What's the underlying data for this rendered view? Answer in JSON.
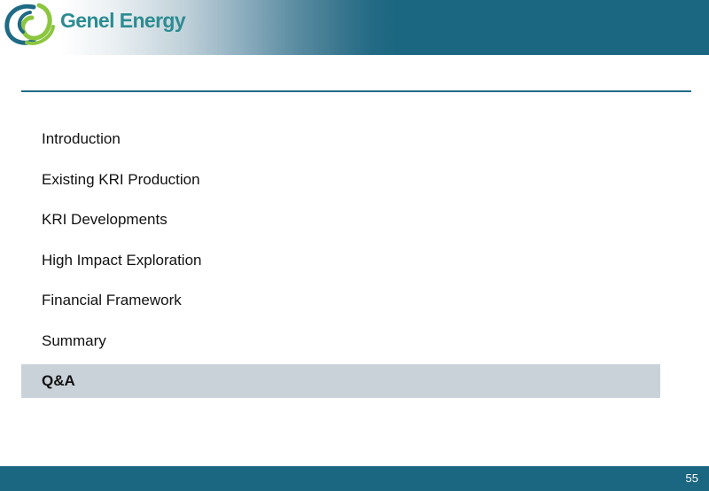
{
  "header": {
    "logo_text": "Genel Energy",
    "logo_icon": "genel-swirl-logo-icon",
    "colors": {
      "band": "#1b6680",
      "logo_text": "#2c8c92",
      "logo_green": "#8cc63f",
      "logo_blue": "#1f6a85"
    }
  },
  "agenda": {
    "items": [
      {
        "label": "Introduction",
        "active": false
      },
      {
        "label": "Existing KRI Production",
        "active": false
      },
      {
        "label": "KRI Developments",
        "active": false
      },
      {
        "label": "High Impact Exploration",
        "active": false
      },
      {
        "label": "Financial Framework",
        "active": false
      },
      {
        "label": "Summary",
        "active": false
      },
      {
        "label": "Q&A",
        "active": true
      }
    ],
    "highlight_color": "#c9d2d9"
  },
  "footer": {
    "page_number": "55"
  }
}
